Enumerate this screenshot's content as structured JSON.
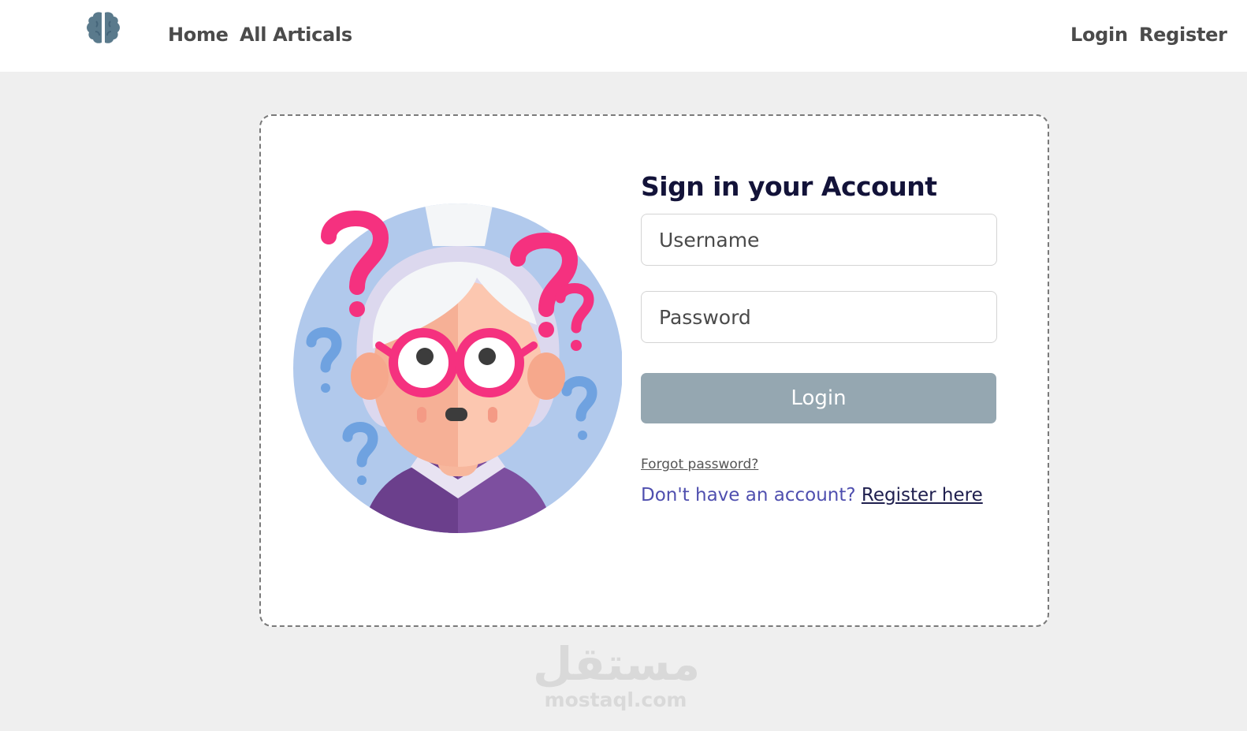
{
  "navbar": {
    "logo_icon": "brain-icon",
    "home_label": "Home",
    "articles_label": "All Articals",
    "login_label": "Login",
    "register_label": "Register"
  },
  "login_form": {
    "title": "Sign in your Account",
    "username_placeholder": "Username",
    "password_placeholder": "Password",
    "submit_label": "Login",
    "forgot_label": "Forgot password?",
    "no_account_text": "Don't have an account? ",
    "register_link_label": "Register here"
  },
  "illustration": {
    "icon": "confused-grandma-illustration"
  },
  "watermark": {
    "arabic": "مستقل",
    "latin": "mostaql.com"
  },
  "colors": {
    "page_bg": "#efefef",
    "nav_text": "#4b4b4b",
    "title": "#131339",
    "button_bg": "#95a7b1",
    "register_text": "#4f4faf",
    "question_pink": "#f5317f",
    "question_blue": "#6fa2e0",
    "circle_bg": "#b1c9ec"
  }
}
